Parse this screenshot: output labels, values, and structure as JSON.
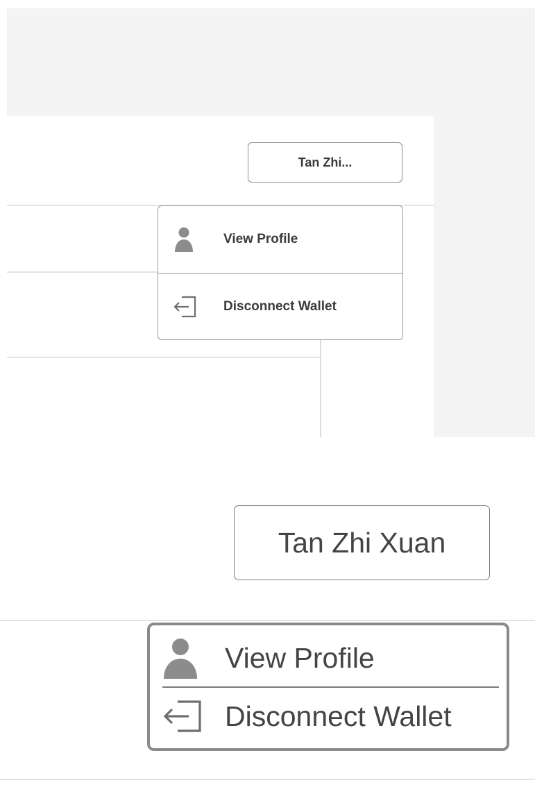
{
  "top_view": {
    "user_button_label": "Tan Zhi...",
    "menu": {
      "items": [
        {
          "label": "View Profile",
          "icon": "person-icon"
        },
        {
          "label": "Disconnect Wallet",
          "icon": "logout-icon"
        }
      ]
    }
  },
  "bottom_view": {
    "user_button_label": "Tan Zhi Xuan",
    "menu": {
      "items": [
        {
          "label": "View Profile",
          "icon": "person-icon"
        },
        {
          "label": "Disconnect Wallet",
          "icon": "logout-icon"
        }
      ]
    }
  },
  "colors": {
    "panel_background": "#f4f4f4",
    "card_background": "#ffffff",
    "border": "#8a8a8a",
    "icon": "#8c8c8c",
    "text": "#3c3c3c"
  }
}
